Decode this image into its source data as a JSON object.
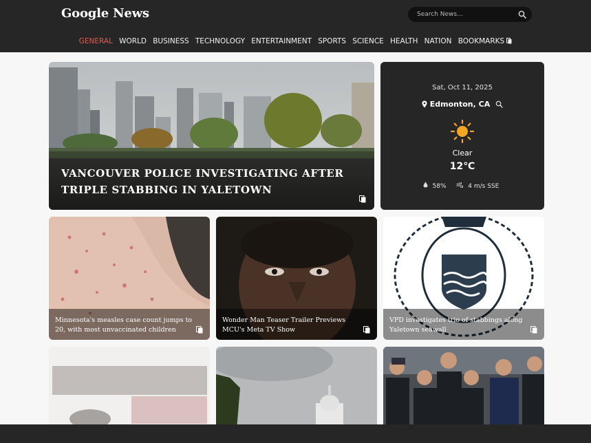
{
  "header": {
    "logo": "Google News",
    "search_placeholder": "Search News..."
  },
  "nav": {
    "items": [
      "GENERAL",
      "WORLD",
      "BUSINESS",
      "TECHNOLOGY",
      "ENTERTAINMENT",
      "SPORTS",
      "SCIENCE",
      "HEALTH",
      "NATION",
      "BOOKMARKS"
    ],
    "active": "GENERAL"
  },
  "hero": {
    "headline": "VANCOUVER POLICE INVESTIGATING AFTER TRIPLE STABBING IN YALETOWN"
  },
  "weather": {
    "date": "Sat, Oct 11, 2025",
    "location": "Edmonton, CA",
    "condition": "Clear",
    "temperature": "12℃",
    "humidity": "58%",
    "wind": "4 m/s SSE",
    "icon": "sun-icon"
  },
  "cards": [
    {
      "headline": "Minnesota's measles case count jumps to 20, with most unvaccinated children"
    },
    {
      "headline": "Wonder Man Teaser Trailer Previews MCU's Meta TV Show"
    },
    {
      "headline": "VPD investigates trio of stabbings along Yaletown seawall"
    }
  ],
  "colors": {
    "header_bg": "#262626",
    "active_nav": "#e8584f",
    "page_bg": "#f7f7f7",
    "sun": "#f5a623"
  }
}
